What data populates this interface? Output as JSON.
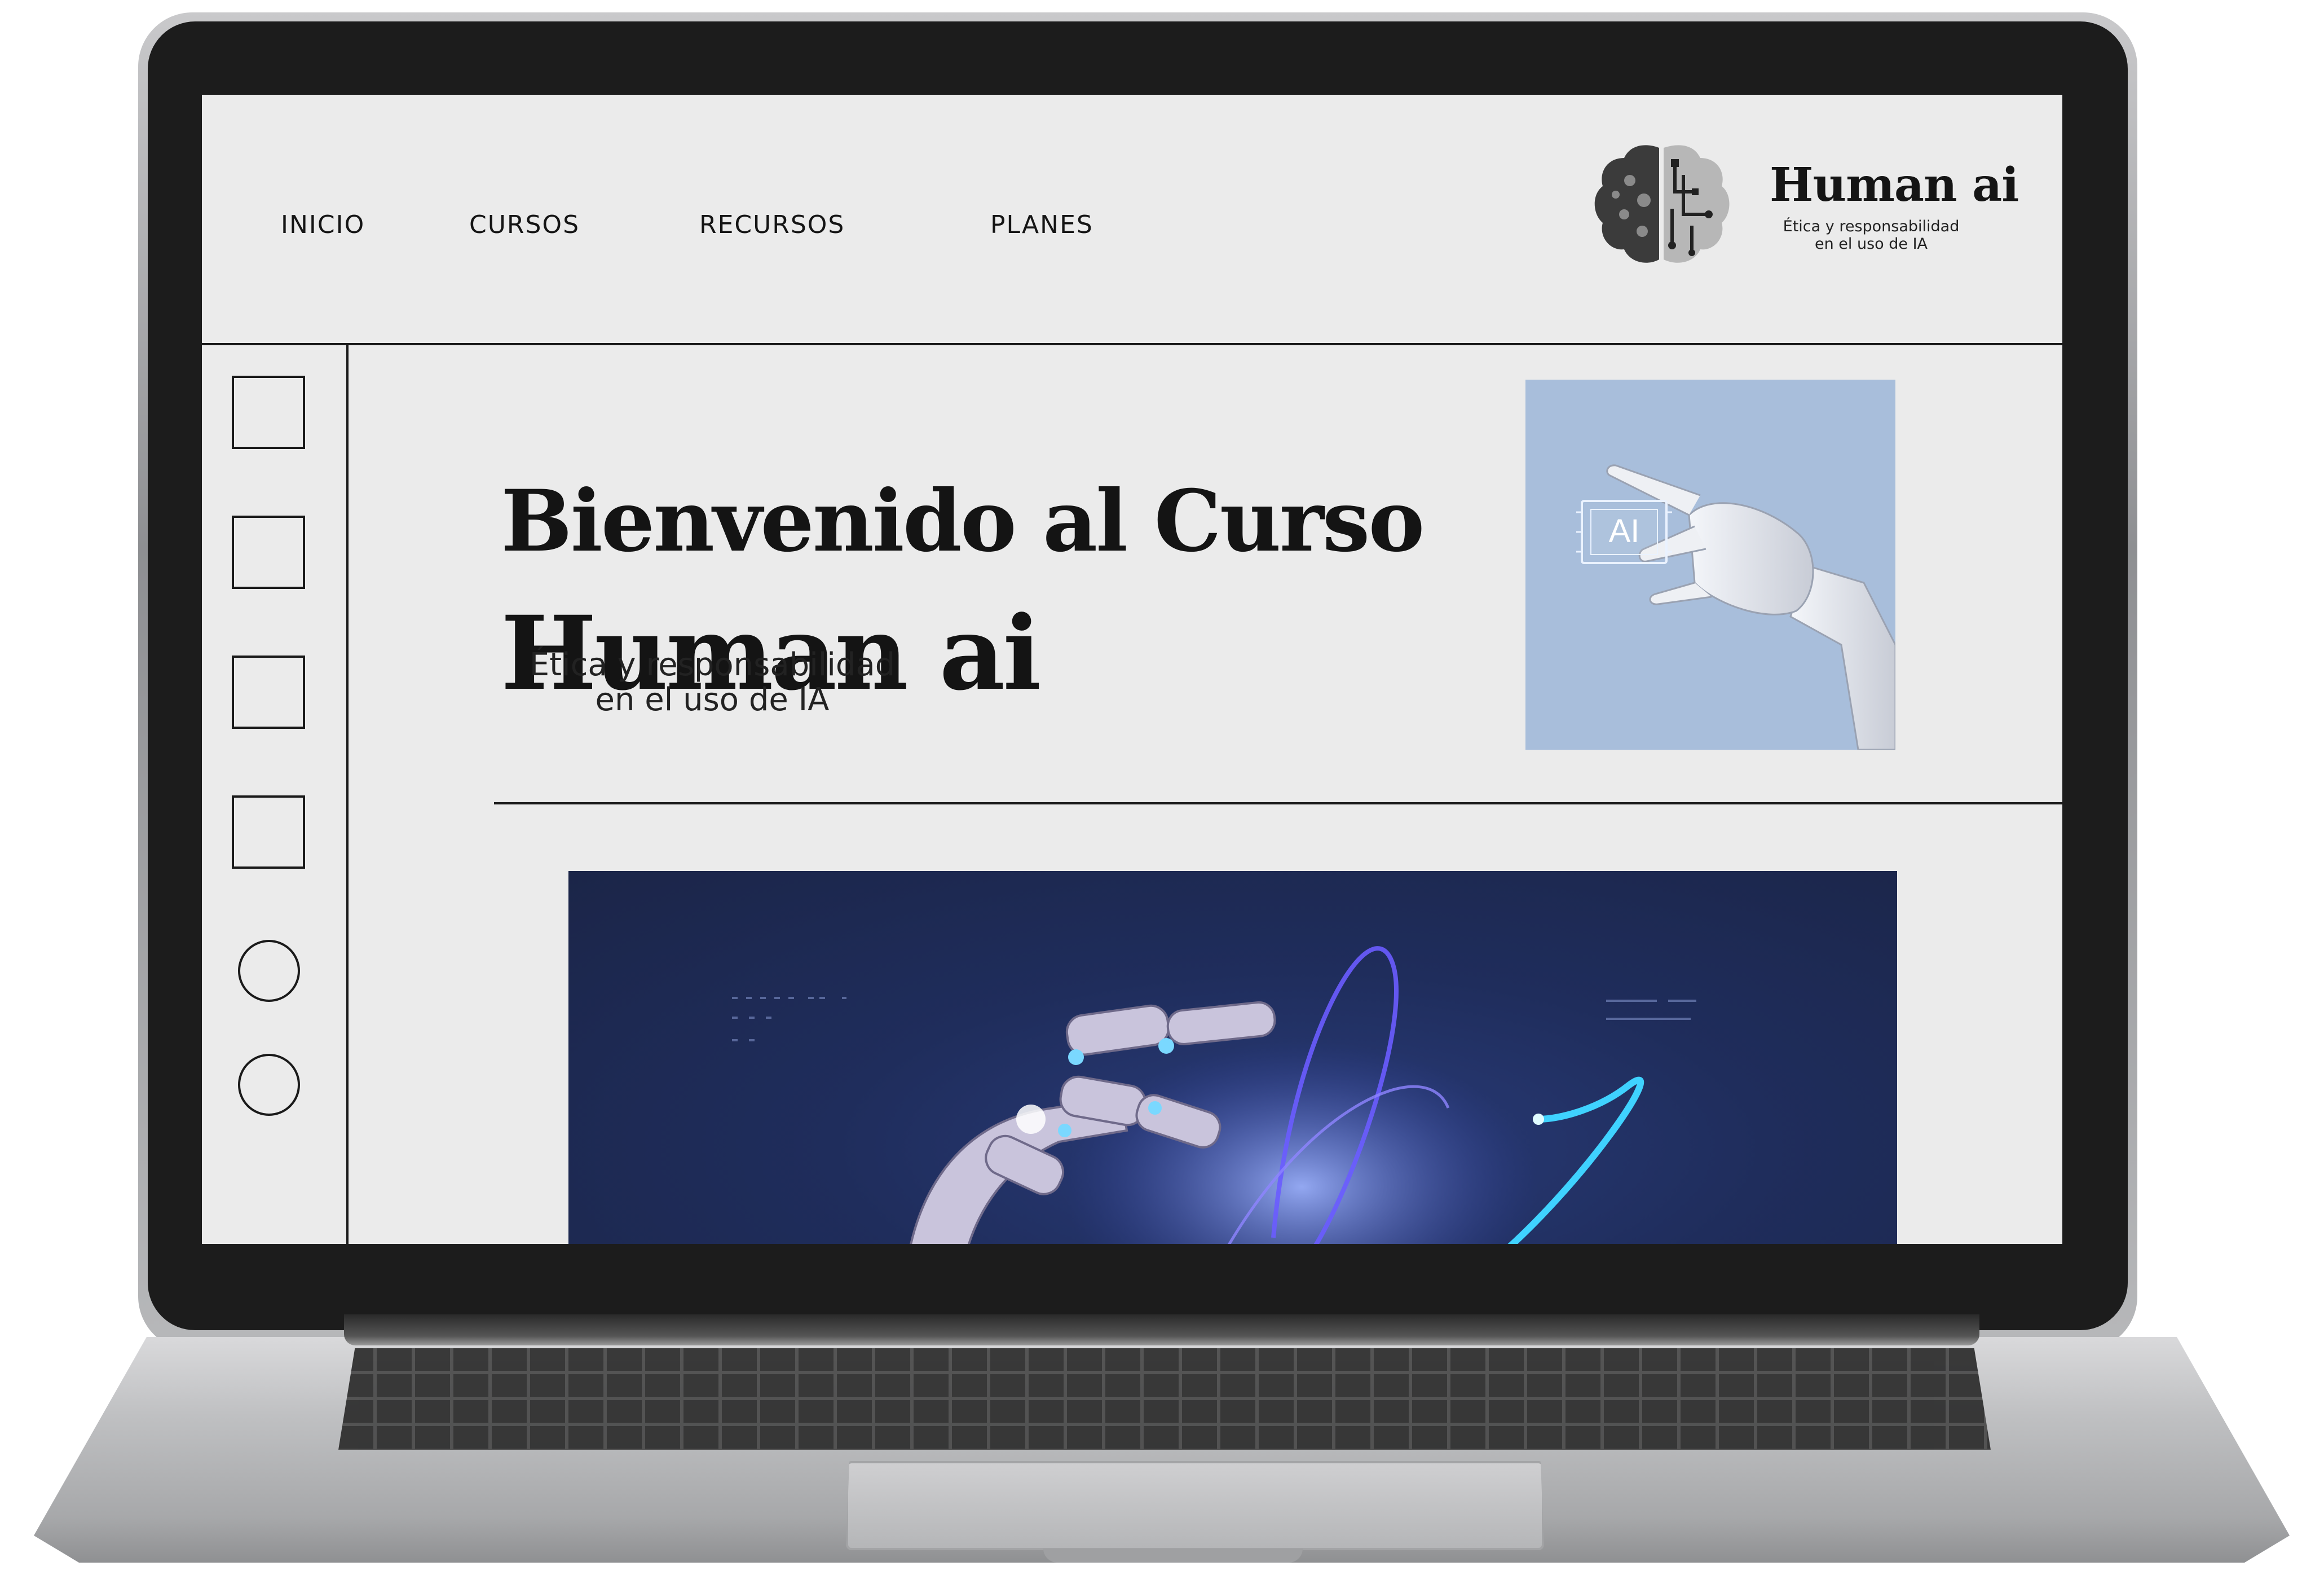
{
  "nav": {
    "items": [
      "INICIO",
      "CURSOS",
      "RECURSOS",
      "PLANES"
    ]
  },
  "brand": {
    "name": "Human ai",
    "tagline_line1": "Ética y responsabilidad",
    "tagline_line2": "en el uso de IA",
    "icon": "brain-circuit-logo"
  },
  "hero": {
    "title_line1": "Bienvenido al Curso",
    "title_line2": "Human ai",
    "subtitle_line1": "Ética y responsabilidad",
    "subtitle_line2": "en el uso de IA",
    "image_badge": "AI",
    "image_icon": "robot-hand-holding-ai-chip"
  },
  "banner": {
    "icon": "robot-hand-light-trails"
  },
  "sidebar": {
    "squares": 4,
    "circles": 2
  },
  "colors": {
    "screen_bg": "#ebebeb",
    "text": "#141414",
    "hero_image_bg": "#a8bedb",
    "banner_bg": "#1f2d5c"
  }
}
